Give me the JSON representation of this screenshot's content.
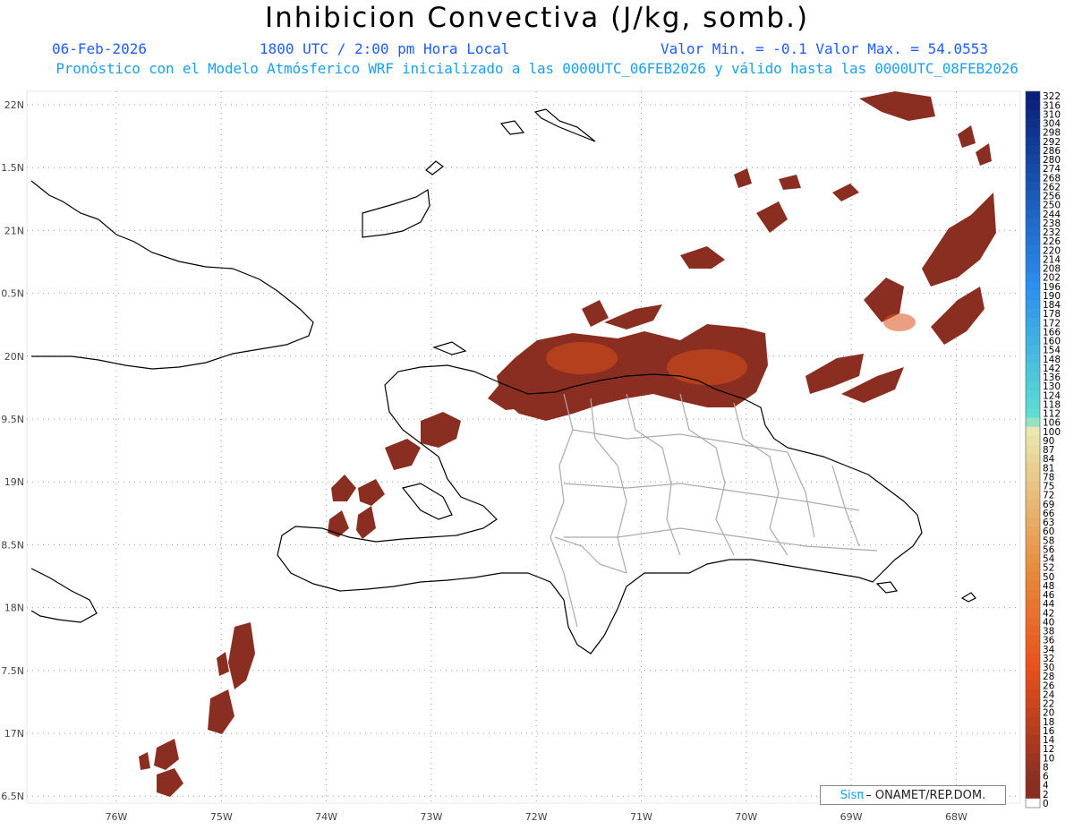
{
  "header": {
    "title": "Inhibicion Convectiva (J/kg, somb.)",
    "date": "06-Feb-2026",
    "time": "1800 UTC / 2:00 pm Hora Local",
    "minmax": "Valor Min. = -0.1  Valor Max. = 54.0553",
    "forecast": "Pronóstico con el Modelo Atmósferico WRF inicializado a las 0000UTC_06FEB2026 y válido hasta las  0000UTC_08FEB2026"
  },
  "map": {
    "lon_labels": [
      "76W",
      "75W",
      "74W",
      "73W",
      "72W",
      "71W",
      "70W",
      "69W",
      "68W"
    ],
    "lat_labels": [
      "22N",
      "1.5N",
      "21N",
      "0.5N",
      "20N",
      "9.5N",
      "19N",
      "8.5N",
      "18N",
      "7.5N",
      "17N",
      "6.5N"
    ],
    "lat_values": [
      22,
      21.5,
      21,
      20.5,
      20,
      19.5,
      19,
      18.5,
      18,
      17.5,
      17,
      16.5
    ],
    "lon_values": [
      -76,
      -75,
      -74,
      -73,
      -72,
      -71,
      -70,
      -69,
      -68
    ],
    "shade_color": "#8b2e22",
    "highlight_color": "#d9501c",
    "coast_color": "#000000",
    "border_color": "#aaaaaa"
  },
  "colorbar": {
    "labels": [
      "322",
      "316",
      "310",
      "304",
      "298",
      "292",
      "286",
      "280",
      "274",
      "268",
      "262",
      "256",
      "250",
      "244",
      "238",
      "232",
      "226",
      "220",
      "214",
      "208",
      "202",
      "196",
      "190",
      "184",
      "178",
      "172",
      "166",
      "160",
      "154",
      "148",
      "142",
      "136",
      "130",
      "124",
      "118",
      "112",
      "106",
      "100",
      "90",
      "87",
      "84",
      "81",
      "78",
      "75",
      "72",
      "69",
      "66",
      "63",
      "60",
      "58",
      "56",
      "54",
      "52",
      "50",
      "48",
      "46",
      "44",
      "42",
      "40",
      "38",
      "36",
      "34",
      "32",
      "30",
      "28",
      "26",
      "24",
      "22",
      "20",
      "18",
      "16",
      "14",
      "12",
      "10",
      "8",
      "6",
      "4",
      "2",
      "0"
    ],
    "colors": {
      "top": "#0a1f7a",
      "mid_blue": "#2a8ef0",
      "cyan": "#5ee0d0",
      "yellow": "#e8e8b0",
      "orange": "#e88a3a",
      "red_orange": "#e8501a",
      "dark_red": "#8b2e22",
      "zero": "#ffffff"
    }
  },
  "credit": {
    "brand": "Sisπ",
    "org": "– ONAMET/REP.DOM."
  }
}
